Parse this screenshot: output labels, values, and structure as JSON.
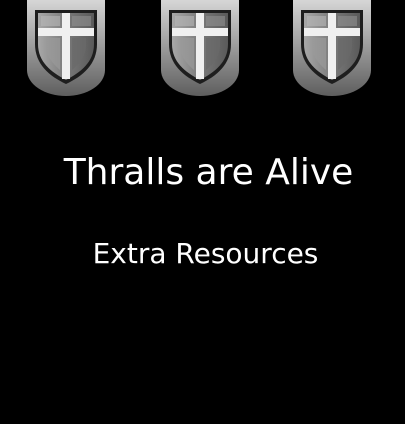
{
  "header": {
    "banners": [
      {
        "icon": "cross-shield-icon"
      },
      {
        "icon": "cross-shield-icon"
      },
      {
        "icon": "cross-shield-icon"
      }
    ]
  },
  "card": {
    "title": "Thralls are Alive",
    "subtitle": "Extra Resources"
  },
  "colors": {
    "background": "#000000",
    "text": "#ffffff",
    "banner_light": "#c9c9c9",
    "banner_dark": "#6e6e6e",
    "shield_face": "#8a8a8a",
    "cross": "#f2f2f2"
  }
}
